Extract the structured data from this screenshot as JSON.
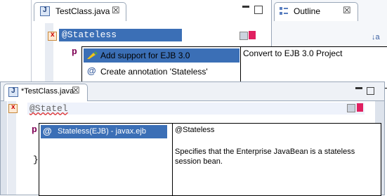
{
  "back_window": {
    "editor_tab": {
      "title": "TestClass.java"
    },
    "outline_tab": {
      "title": "Outline"
    },
    "code": {
      "annotation": "@Stateless",
      "p": "p"
    },
    "quick_fix": {
      "items": [
        {
          "label": "Add support for EJB 3.0"
        },
        {
          "label": "Create annotation 'Stateless'"
        }
      ],
      "description": "Convert to EJB 3.0 Project"
    }
  },
  "front_window": {
    "editor_tab": {
      "title": "*TestClass.java"
    },
    "code": {
      "annotation": "@Statel",
      "p": "p",
      "brace": "}"
    },
    "content_assist": {
      "items": [
        {
          "label": "Stateless(EJB) - javax.ejb"
        }
      ]
    },
    "javadoc": {
      "heading": "@Stateless",
      "body": "Specifies that the Enterprise JavaBean is a stateless session bean."
    }
  },
  "glyphs": {
    "close": "☒",
    "at": "@"
  },
  "icons": [
    "java-file-icon",
    "close-icon",
    "outline-icon",
    "error-icon",
    "minimize-icon",
    "maximize-icon",
    "quickfix-icon",
    "annotation-icon"
  ]
}
